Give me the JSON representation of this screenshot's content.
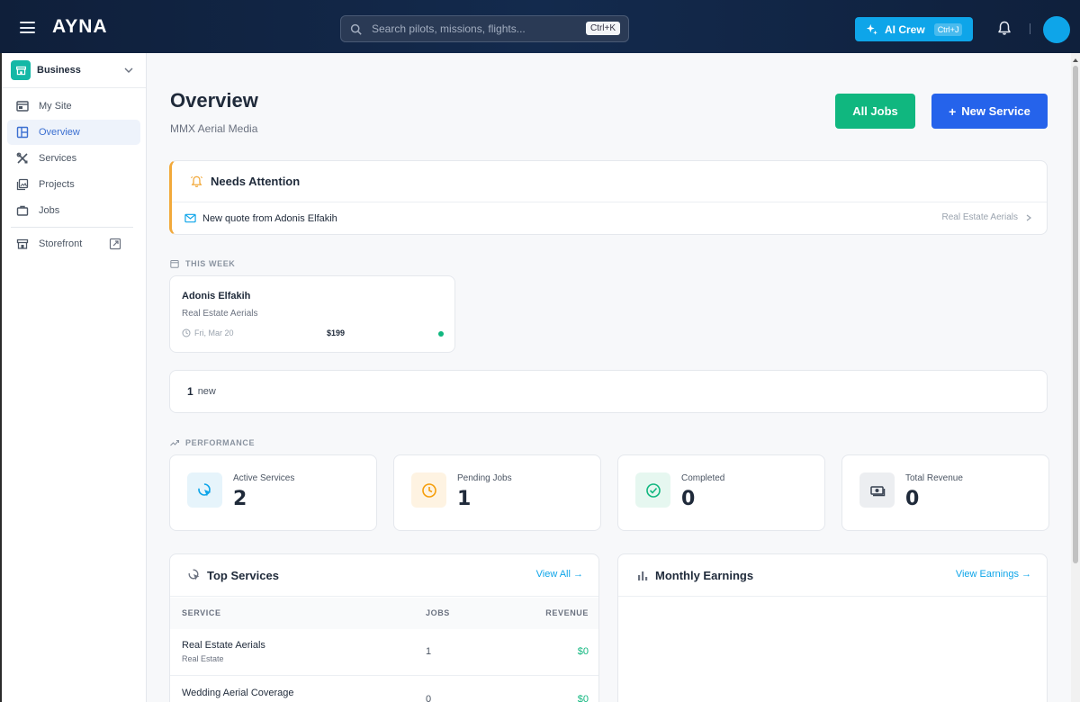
{
  "header": {
    "logo": "AYNA",
    "search_placeholder": "Search pilots, missions, flights...",
    "search_shortcut": "Ctrl+K",
    "ai_button_label": "AI Crew",
    "ai_shortcut": "Ctrl+J"
  },
  "sidebar": {
    "business_label": "Business",
    "items": [
      {
        "label": "My Site",
        "icon": "layout-icon",
        "active": false
      },
      {
        "label": "Overview",
        "icon": "dashboard-icon",
        "active": true
      },
      {
        "label": "Services",
        "icon": "tools-icon",
        "active": false
      },
      {
        "label": "Projects",
        "icon": "gallery-icon",
        "active": false
      },
      {
        "label": "Jobs",
        "icon": "briefcase-icon",
        "active": false
      }
    ],
    "storefront_label": "Storefront"
  },
  "page": {
    "title": "Overview",
    "subtitle": "MMX Aerial Media",
    "all_jobs_label": "All Jobs",
    "new_service_label": "New Service",
    "new_service_plus": "+"
  },
  "attention": {
    "title": "Needs Attention",
    "item_text": "New quote from Adonis Elfakih",
    "item_service": "Real Estate Aerials"
  },
  "this_week": {
    "label": "THIS WEEK",
    "job": {
      "name": "Adonis Elfakih",
      "service": "Real Estate Aerials",
      "date": "Fri, Mar 20",
      "price": "$199"
    }
  },
  "new_count": {
    "count": "1",
    "label": "new"
  },
  "performance": {
    "label": "PERFORMANCE",
    "stats": [
      {
        "label": "Active Services",
        "value": "2",
        "icon": "cursor-click-icon",
        "bg": "#e6f4fb",
        "color": "#0ea5e9"
      },
      {
        "label": "Pending Jobs",
        "value": "1",
        "icon": "clock-icon",
        "bg": "#fef3e2",
        "color": "#f59e0b"
      },
      {
        "label": "Completed",
        "value": "0",
        "icon": "check-circle-icon",
        "bg": "#e6f7f0",
        "color": "#10b77f"
      },
      {
        "label": "Total Revenue",
        "value": "0",
        "icon": "money-icon",
        "bg": "#eceef1",
        "color": "#374151"
      }
    ]
  },
  "top_services": {
    "title": "Top Services",
    "link": "View All →",
    "columns": [
      "SERVICE",
      "JOBS",
      "REVENUE"
    ],
    "rows": [
      {
        "name": "Real Estate Aerials",
        "category": "Real Estate",
        "jobs": "1",
        "revenue": "$0"
      },
      {
        "name": "Wedding Aerial Coverage",
        "category": "",
        "jobs": "0",
        "revenue": "$0"
      }
    ]
  },
  "earnings": {
    "title": "Monthly Earnings",
    "link": "View Earnings →"
  },
  "colors": {
    "accent": "#0ea5e9",
    "green": "#10b77f",
    "blue": "#2563eb",
    "warning": "#f2a93b"
  }
}
